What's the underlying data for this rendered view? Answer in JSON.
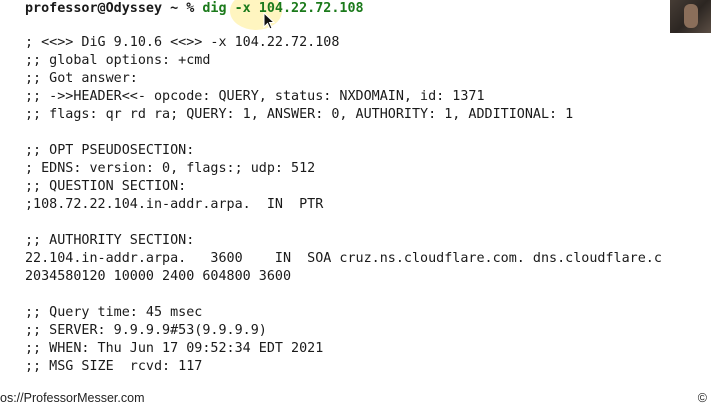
{
  "prompt": {
    "host_text": "professor@Odyssey ~ % ",
    "command": "dig -x 104.22.72.108"
  },
  "output_lines": [
    "; <<>> DiG 9.10.6 <<>> -x 104.22.72.108",
    ";; global options: +cmd",
    ";; Got answer:",
    ";; ->>HEADER<<- opcode: QUERY, status: NXDOMAIN, id: 1371",
    ";; flags: qr rd ra; QUERY: 1, ANSWER: 0, AUTHORITY: 1, ADDITIONAL: 1",
    "",
    ";; OPT PSEUDOSECTION:",
    "; EDNS: version: 0, flags:; udp: 512",
    ";; QUESTION SECTION:",
    ";108.72.22.104.in-addr.arpa.  IN  PTR",
    "",
    ";; AUTHORITY SECTION:",
    "22.104.in-addr.arpa.   3600    IN  SOA cruz.ns.cloudflare.com. dns.cloudflare.c",
    "2034580120 10000 2400 604800 3600",
    "",
    ";; Query time: 45 msec",
    ";; SERVER: 9.9.9.9#53(9.9.9.9)",
    ";; WHEN: Thu Jun 17 09:52:34 EDT 2021",
    ";; MSG SIZE  rcvd: 117"
  ],
  "footer": {
    "url": "os://ProfessorMesser.com",
    "copyright": "©"
  },
  "icons": {
    "cursor": "mouse-pointer-icon"
  }
}
